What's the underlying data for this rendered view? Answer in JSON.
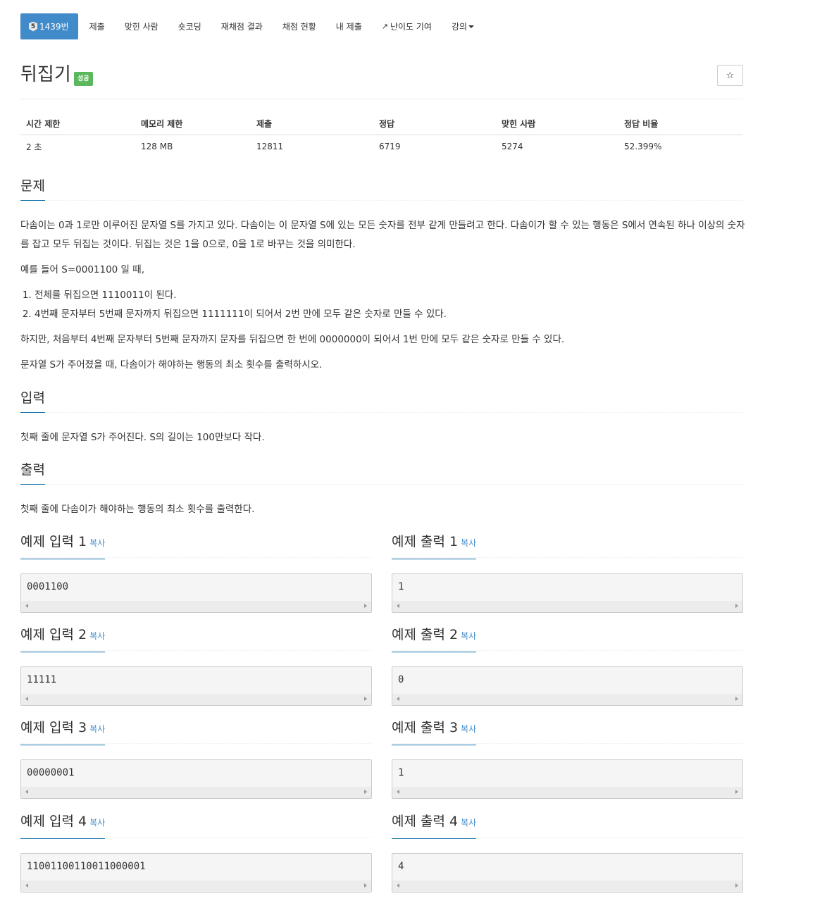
{
  "nav": {
    "problem_badge": "5",
    "problem_label": "1439번",
    "tabs": [
      "제출",
      "맞힌 사람",
      "숏코딩",
      "재채점 결과",
      "채점 현황",
      "내 제출",
      "난이도 기여",
      "강의"
    ]
  },
  "problem": {
    "title": "뒤집기",
    "status_label": "성공",
    "star": "☆"
  },
  "info": {
    "headers": [
      "시간 제한",
      "메모리 제한",
      "제출",
      "정답",
      "맞힌 사람",
      "정답 비율"
    ],
    "values": [
      "2 초",
      "128 MB",
      "12811",
      "6719",
      "5274",
      "52.399%"
    ]
  },
  "sections": {
    "description_title": "문제",
    "description": [
      "다솜이는 0과 1로만 이루어진 문자열 S를 가지고 있다. 다솜이는 이 문자열 S에 있는 모든 숫자를 전부 같게 만들려고 한다. 다솜이가 할 수 있는 행동은 S에서 연속된 하나 이상의 숫자를 잡고 모두 뒤집는 것이다. 뒤집는 것은 1을 0으로, 0을 1로 바꾸는 것을 의미한다.",
      "예를 들어 S=0001100 일 때,",
      "하지만, 처음부터 4번째 문자부터 5번째 문자까지 문자를 뒤집으면 한 번에 0000000이 되어서 1번 만에 모두 같은 숫자로 만들 수 있다.",
      "문자열 S가 주어졌을 때, 다솜이가 해야하는 행동의 최소 횟수를 출력하시오."
    ],
    "list": [
      "전체를 뒤집으면 1110011이 된다.",
      "4번째 문자부터 5번째 문자까지 뒤집으면 1111111이 되어서 2번 만에 모두 같은 숫자로 만들 수 있다."
    ],
    "input_title": "입력",
    "input": "첫째 줄에 문자열 S가 주어진다. S의 길이는 100만보다 작다.",
    "output_title": "출력",
    "output": "첫째 줄에 다솜이가 해야하는 행동의 최소 횟수를 출력한다."
  },
  "samples": {
    "copy_label": "복사",
    "items": [
      {
        "in_title": "예제 입력 1",
        "in": "0001100",
        "out_title": "예제 출력 1",
        "out": "1"
      },
      {
        "in_title": "예제 입력 2",
        "in": "11111",
        "out_title": "예제 출력 2",
        "out": "0"
      },
      {
        "in_title": "예제 입력 3",
        "in": "00000001",
        "out_title": "예제 출력 3",
        "out": "1"
      },
      {
        "in_title": "예제 입력 4",
        "in": "11001100110011000001",
        "out_title": "예제 출력 4",
        "out": "4"
      }
    ]
  }
}
